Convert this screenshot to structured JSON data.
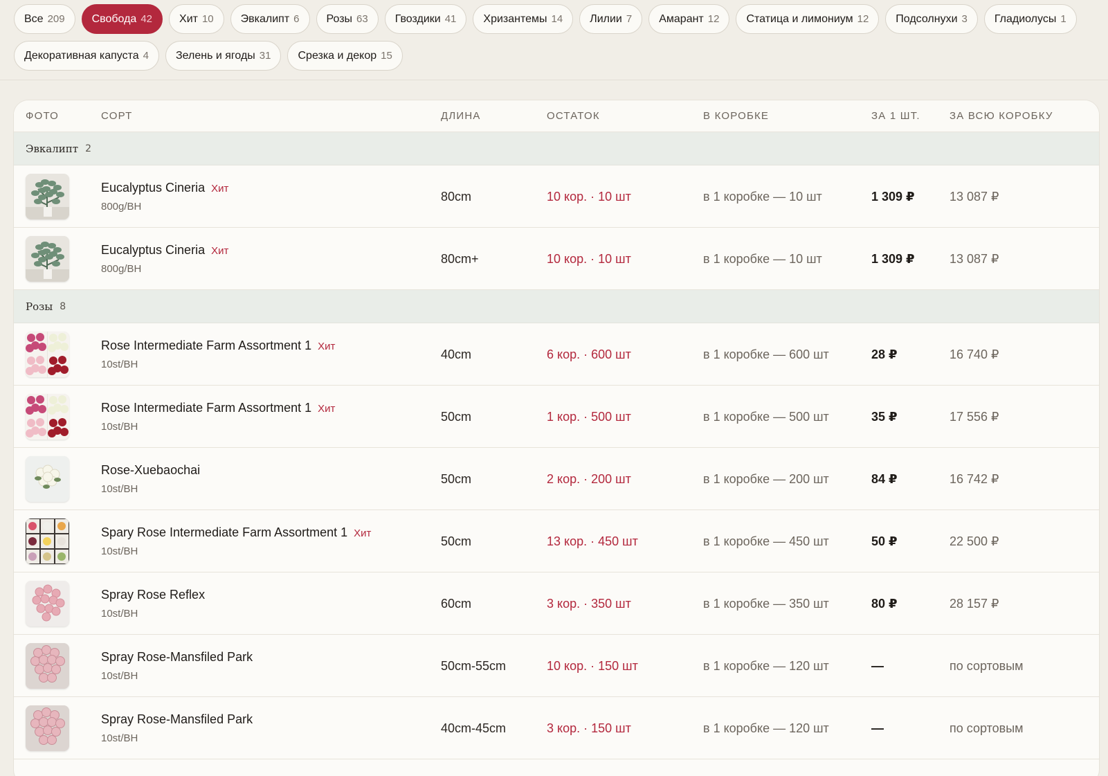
{
  "filters": [
    {
      "label": "Все",
      "count": "209",
      "active": false
    },
    {
      "label": "Свобода",
      "count": "42",
      "active": true
    },
    {
      "label": "Хит",
      "count": "10",
      "active": false
    },
    {
      "label": "Эвкалипт",
      "count": "6",
      "active": false
    },
    {
      "label": "Розы",
      "count": "63",
      "active": false
    },
    {
      "label": "Гвоздики",
      "count": "41",
      "active": false
    },
    {
      "label": "Хризантемы",
      "count": "14",
      "active": false
    },
    {
      "label": "Лилии",
      "count": "7",
      "active": false
    },
    {
      "label": "Амарант",
      "count": "12",
      "active": false
    },
    {
      "label": "Статица и лимониум",
      "count": "12",
      "active": false
    },
    {
      "label": "Подсолнухи",
      "count": "3",
      "active": false
    },
    {
      "label": "Гладиолусы",
      "count": "1",
      "active": false
    },
    {
      "label": "Декоративная капуста",
      "count": "4",
      "active": false
    },
    {
      "label": "Зелень и ягоды",
      "count": "31",
      "active": false
    },
    {
      "label": "Срезка и декор",
      "count": "15",
      "active": false
    }
  ],
  "table": {
    "headers": {
      "photo": "Фото",
      "sort": "Сорт",
      "length": "Длина",
      "stock": "Остаток",
      "box": "В коробке",
      "unit": "За 1 шт.",
      "total": "За всю коробку"
    },
    "groups": [
      {
        "name": "Эвкалипт",
        "count": "2",
        "rows": [
          {
            "photo": "eucalyptus",
            "name": "Eucalyptus Cineria",
            "hit": "Хит",
            "pack": "800g/BH",
            "length": "80cm",
            "stock": "10 кор. · 10 шт",
            "box": "в 1 коробке — 10 шт",
            "unit": "1 309 ₽",
            "total": "13 087 ₽"
          },
          {
            "photo": "eucalyptus",
            "name": "Eucalyptus Cineria",
            "hit": "Хит",
            "pack": "800g/BH",
            "length": "80cm+",
            "stock": "10 кор. · 10 шт",
            "box": "в 1 коробке — 10 шт",
            "unit": "1 309 ₽",
            "total": "13 087 ₽"
          }
        ]
      },
      {
        "name": "Розы",
        "count": "8",
        "rows": [
          {
            "photo": "rose-assortment",
            "name": "Rose Intermediate Farm Assortment 1",
            "hit": "Хит",
            "pack": "10st/BH",
            "length": "40cm",
            "stock": "6 кор. · 600 шт",
            "box": "в 1 коробке — 600 шт",
            "unit": "28 ₽",
            "total": "16 740 ₽"
          },
          {
            "photo": "rose-assortment",
            "name": "Rose Intermediate Farm Assortment 1",
            "hit": "Хит",
            "pack": "10st/BH",
            "length": "50cm",
            "stock": "1 кор. · 500 шт",
            "box": "в 1 коробке — 500 шт",
            "unit": "35 ₽",
            "total": "17 556 ₽"
          },
          {
            "photo": "rose-white",
            "name": "Rose-Xuebaochai",
            "hit": "",
            "pack": "10st/BH",
            "length": "50cm",
            "stock": "2 кор. · 200 шт",
            "box": "в 1 коробке — 200 шт",
            "unit": "84 ₽",
            "total": "16 742 ₽"
          },
          {
            "photo": "spray-assortment",
            "name": "Spary Rose Intermediate Farm Assortment 1",
            "hit": "Хит",
            "pack": "10st/BH",
            "length": "50cm",
            "stock": "13 кор. · 450 шт",
            "box": "в 1 коробке — 450 шт",
            "unit": "50 ₽",
            "total": "22 500 ₽"
          },
          {
            "photo": "spray-pink",
            "name": "Spray Rose Reflex",
            "hit": "",
            "pack": "10st/BH",
            "length": "60cm",
            "stock": "3 кор. · 350 шт",
            "box": "в 1 коробке — 350 шт",
            "unit": "80 ₽",
            "total": "28 157 ₽"
          },
          {
            "photo": "spray-pink-bouquet",
            "name": "Spray Rose-Mansfiled Park",
            "hit": "",
            "pack": "10st/BH",
            "length": "50cm-55cm",
            "stock": "10 кор. · 150 шт",
            "box": "в 1 коробке — 120 шт",
            "unit": "—",
            "total": "по сортовым"
          },
          {
            "photo": "spray-pink-bouquet",
            "name": "Spray Rose-Mansfiled Park",
            "hit": "",
            "pack": "10st/BH",
            "length": "40cm-45cm",
            "stock": "3 кор. · 150 шт",
            "box": "в 1 коробке — 120 шт",
            "unit": "—",
            "total": "по сортовым"
          }
        ]
      }
    ]
  }
}
